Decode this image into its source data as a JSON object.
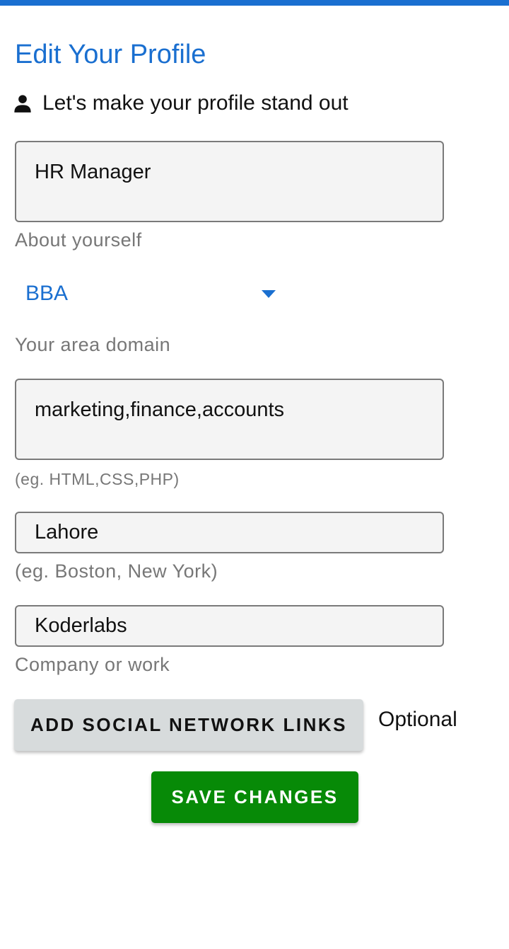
{
  "page": {
    "title": "Edit Your Profile",
    "subtitle": "Let's make your profile stand out"
  },
  "form": {
    "about": {
      "value": "HR Manager",
      "helper": "About yourself"
    },
    "degree": {
      "selected": "BBA",
      "helper": "Your area domain"
    },
    "skills": {
      "value": "marketing,finance,accounts",
      "helper": "(eg. HTML,CSS,PHP)"
    },
    "city": {
      "value": "Lahore",
      "helper": "(eg. Boston, New York)"
    },
    "company": {
      "value": "Koderlabs",
      "helper": "Company or work"
    }
  },
  "actions": {
    "social_label": "ADD SOCIAL NETWORK LINKS",
    "optional_label": "Optional",
    "save_label": "SAVE CHANGES"
  },
  "icons": {
    "subtitle_icon": "person-icon",
    "dropdown_icon": "caret-down-icon"
  },
  "colors": {
    "accent": "#1a6fd0",
    "save_button": "#078a07",
    "secondary_button": "#d7dbdc",
    "helper_text": "#777777"
  }
}
